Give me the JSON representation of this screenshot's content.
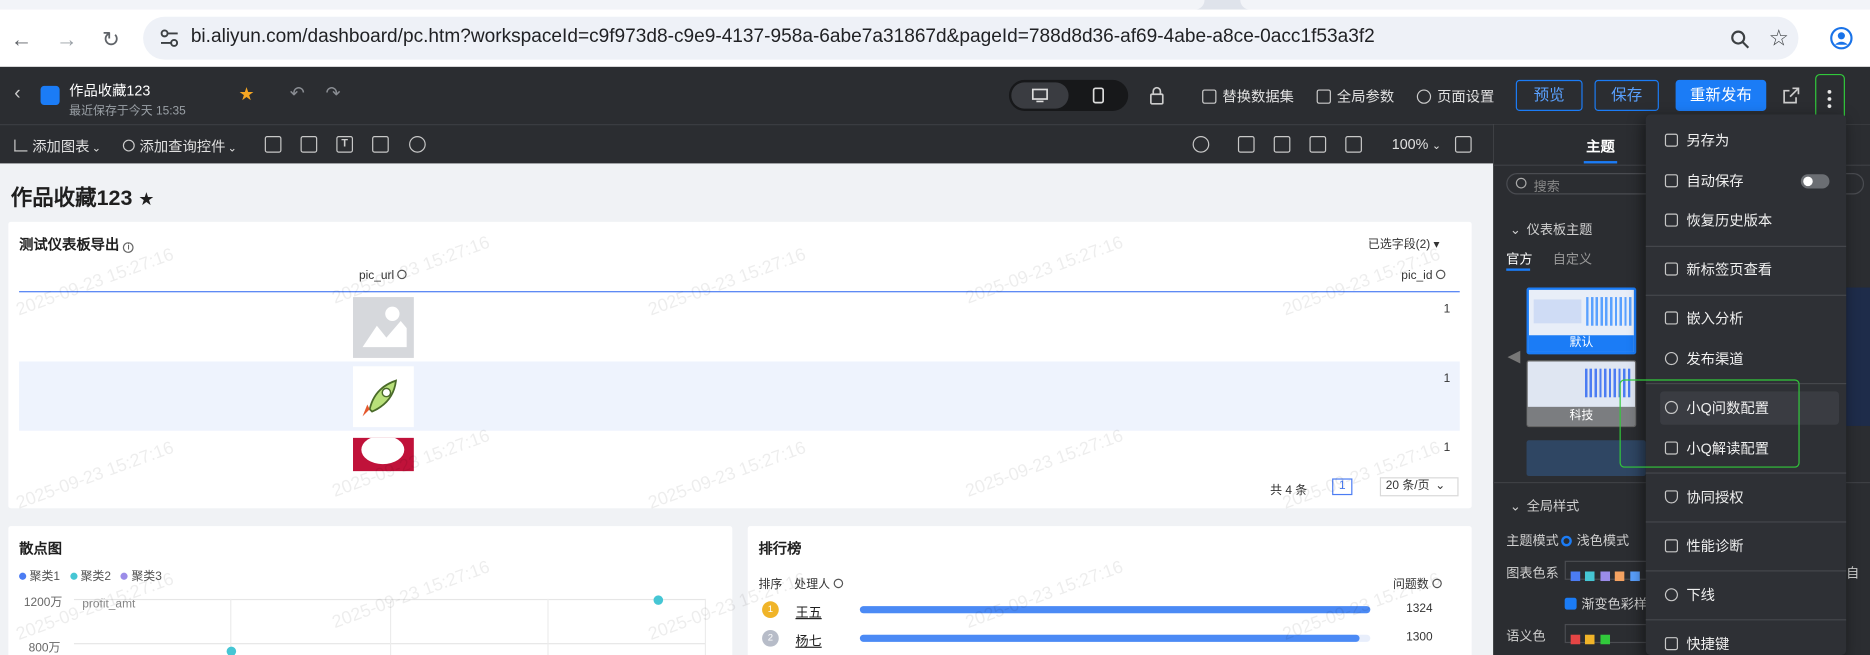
{
  "browser": {
    "url": "bi.aliyun.com/dashboard/pc.htm?workspaceId=c9f973d8-c9e9-4137-958a-6abe7a31867d&pageId=788d8d36-af69-4abe-a8ce-0acc1f53a3f2"
  },
  "header": {
    "title": "作品收藏123",
    "saved_at": "最近保存于今天 15:35",
    "replace_dataset": "替换数据集",
    "global_params": "全局参数",
    "page_settings": "页面设置",
    "preview": "预览",
    "save": "保存",
    "republish": "重新发布"
  },
  "toolbar": {
    "add_chart": "添加图表",
    "add_query": "添加查询控件",
    "zoom": "100%"
  },
  "page": {
    "title": "作品收藏123",
    "watermark": "2025-09-23 15:27:16"
  },
  "table_card": {
    "title": "测试仪表板导出",
    "selected_fields": "已选字段(2)",
    "columns": [
      "pic_url",
      "pic_id"
    ],
    "rows": [
      {
        "pic_id": "1"
      },
      {
        "pic_id": "1"
      },
      {
        "pic_id": "1"
      }
    ],
    "total": "共 4 条",
    "page": "1",
    "page_size": "20 条/页"
  },
  "scatter_card": {
    "title": "散点图",
    "legend": [
      "聚类1",
      "聚类2",
      "聚类3"
    ],
    "legend_colors": [
      "#4b7cf3",
      "#45c6d4",
      "#9b8ce8"
    ],
    "y_ticks": [
      "1200万",
      "800万"
    ],
    "field": "profit_amt"
  },
  "rank_card": {
    "title": "排行榜",
    "col_rank": "排序",
    "col_handler": "处理人",
    "col_count": "问题数",
    "rows": [
      {
        "name": "王五",
        "value": "1324",
        "fill": 1.0
      },
      {
        "name": "杨七",
        "value": "1300",
        "fill": 0.98
      }
    ]
  },
  "right_panel": {
    "tab_theme": "主题",
    "search_placeholder": "搜索",
    "dash_theme": "仪表板主题",
    "official": "官方",
    "custom": "自定义",
    "theme_default": "默认",
    "theme_tech": "科技",
    "global_style": "全局样式",
    "theme_mode": "主题模式",
    "light_mode": "浅色模式",
    "chart_palette": "图表色系",
    "gradient": "渐变色彩样式",
    "semantic_color": "语义色",
    "auto": "自"
  },
  "menu": {
    "items": [
      "另存为",
      "自动保存",
      "恢复历史版本",
      "新标签页查看",
      "嵌入分析",
      "发布渠道",
      "小Q问数配置",
      "小Q解读配置",
      "协同授权",
      "性能诊断",
      "下线",
      "快捷键"
    ]
  }
}
